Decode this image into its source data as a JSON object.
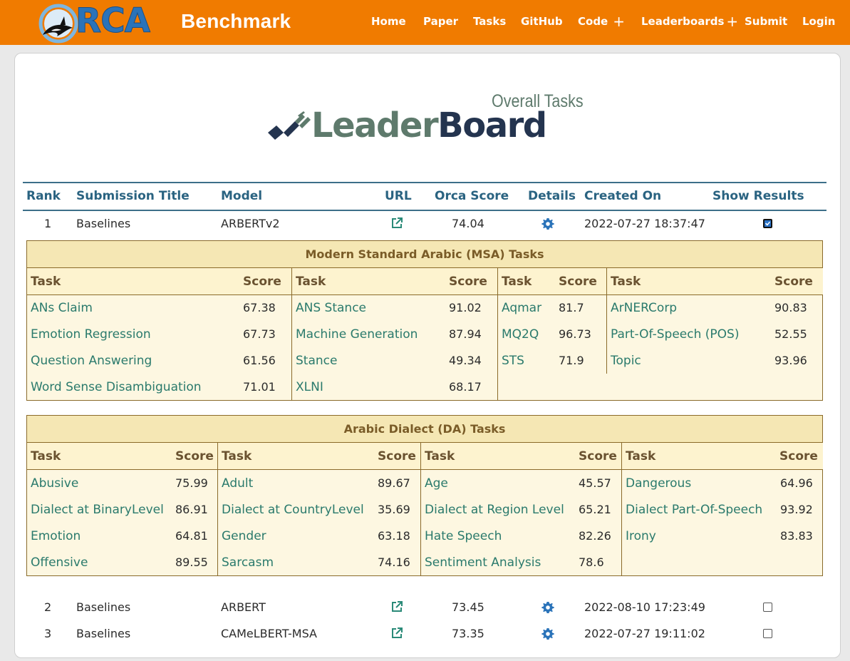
{
  "navbar": {
    "logo_text": "RCA",
    "brand": "Benchmark",
    "items": [
      {
        "label": "Home"
      },
      {
        "label": "Paper"
      },
      {
        "label": "Tasks"
      },
      {
        "label": "GitHub"
      },
      {
        "label": "Code"
      },
      {
        "label": "Leaderboards"
      },
      {
        "label": "Submit"
      },
      {
        "label": "Login"
      }
    ],
    "accent": "#f07b00"
  },
  "banner": {
    "subtitle": "Overall Tasks",
    "title_part1": "Leader",
    "title_part2": "Board"
  },
  "table": {
    "headers": {
      "rank": "Rank",
      "title": "Submission Title",
      "model": "Model",
      "url": "URL",
      "score": "Orca Score",
      "details": "Details",
      "created": "Created On",
      "show": "Show Results"
    },
    "rows": [
      {
        "rank": "1",
        "title": "Baselines",
        "model": "ARBERTv2",
        "score": "74.04",
        "created": "2022-07-27 18:37:47",
        "show_results": true
      },
      {
        "rank": "2",
        "title": "Baselines",
        "model": "ARBERT",
        "score": "73.45",
        "created": "2022-08-10 17:23:49",
        "show_results": false
      },
      {
        "rank": "3",
        "title": "Baselines",
        "model": "CAMeLBERT-MSA",
        "score": "73.35",
        "created": "2022-07-27 19:11:02",
        "show_results": false
      }
    ]
  },
  "msa": {
    "title": "Modern Standard Arabic (MSA) Tasks",
    "task_header": "Task",
    "score_header": "Score",
    "columns": [
      [
        {
          "task": "ANs Claim",
          "score": "67.38"
        },
        {
          "task": "Emotion Regression",
          "score": "67.73"
        },
        {
          "task": "Question Answering",
          "score": "61.56"
        },
        {
          "task": "Word Sense Disambiguation",
          "score": "71.01"
        }
      ],
      [
        {
          "task": "ANS Stance",
          "score": "91.02"
        },
        {
          "task": "Machine Generation",
          "score": "87.94"
        },
        {
          "task": "Stance",
          "score": "49.34"
        },
        {
          "task": "XLNI",
          "score": "68.17"
        }
      ],
      [
        {
          "task": "Aqmar",
          "score": "81.7"
        },
        {
          "task": "MQ2Q",
          "score": "96.73"
        },
        {
          "task": "STS",
          "score": "71.9"
        }
      ],
      [
        {
          "task": "ArNERCorp",
          "score": "90.83"
        },
        {
          "task": "Part-Of-Speech (POS)",
          "score": "52.55"
        },
        {
          "task": "Topic",
          "score": "93.96"
        }
      ]
    ]
  },
  "da": {
    "title": "Arabic Dialect (DA) Tasks",
    "task_header": "Task",
    "score_header": "Score",
    "columns": [
      [
        {
          "task": "Abusive",
          "score": "75.99"
        },
        {
          "task": "Dialect at BinaryLevel",
          "score": "86.91"
        },
        {
          "task": "Emotion",
          "score": "64.81"
        },
        {
          "task": "Offensive",
          "score": "89.55"
        }
      ],
      [
        {
          "task": "Adult",
          "score": "89.67"
        },
        {
          "task": "Dialect at CountryLevel",
          "score": "35.69"
        },
        {
          "task": "Gender",
          "score": "63.18"
        },
        {
          "task": "Sarcasm",
          "score": "74.16"
        }
      ],
      [
        {
          "task": "Age",
          "score": "45.57"
        },
        {
          "task": "Dialect at Region Level",
          "score": "65.21"
        },
        {
          "task": "Hate Speech",
          "score": "82.26"
        },
        {
          "task": "Sentiment Analysis",
          "score": "78.6"
        }
      ],
      [
        {
          "task": "Dangerous",
          "score": "64.96"
        },
        {
          "task": "Dialect Part-Of-Speech",
          "score": "93.92"
        },
        {
          "task": "Irony",
          "score": "83.83"
        }
      ]
    ]
  }
}
